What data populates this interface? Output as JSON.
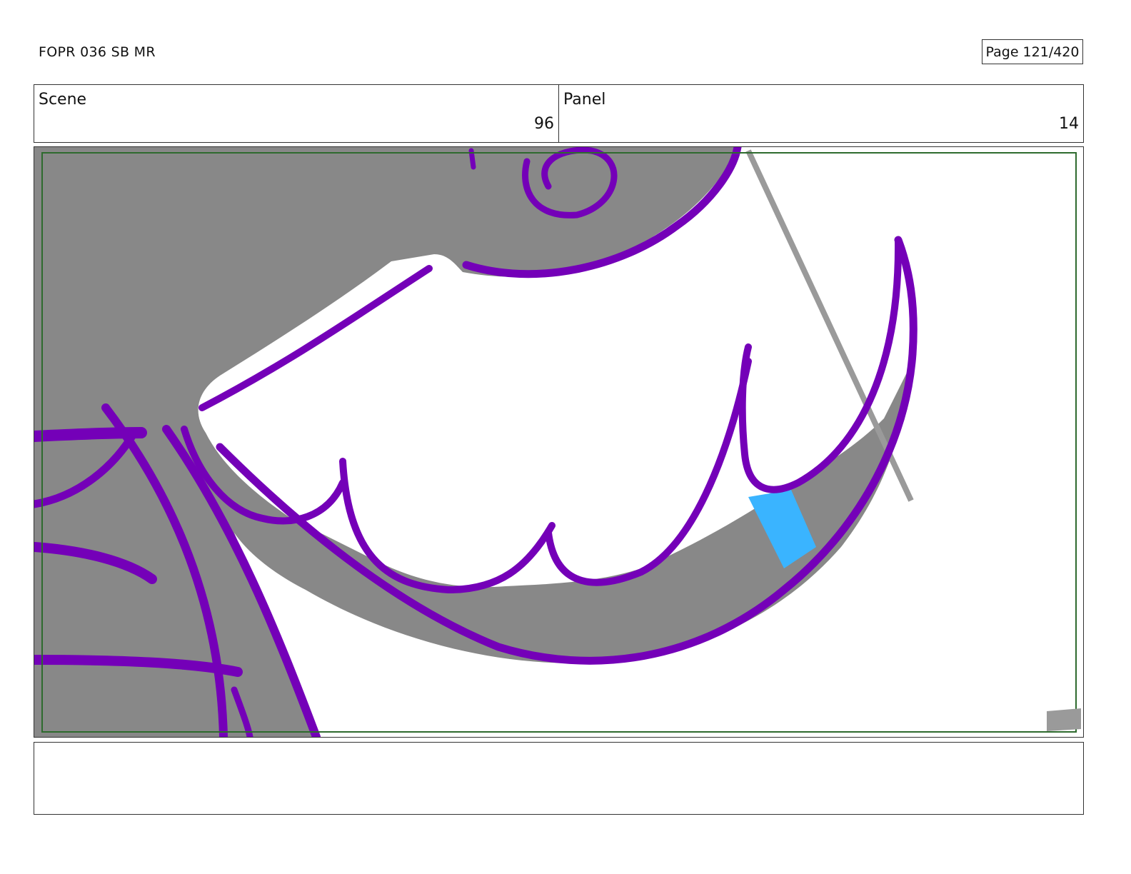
{
  "header": {
    "title": "FOPR 036 SB MR",
    "page_label": "Page 121/420"
  },
  "info": {
    "scene_label": "Scene",
    "scene_value": "96",
    "panel_label": "Panel",
    "panel_value": "14"
  },
  "notes": {
    "text": ""
  },
  "colors": {
    "line": "#7400b8",
    "fill": "#888888",
    "accent": "#3ab4ff",
    "safe_area": "#2e6b2e",
    "border": "#333333"
  }
}
